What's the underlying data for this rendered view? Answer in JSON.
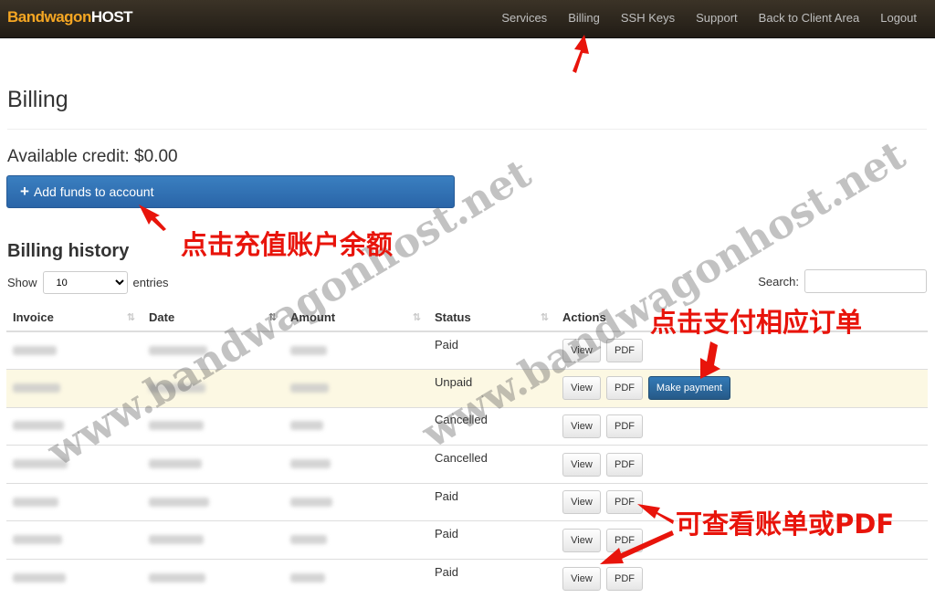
{
  "brand": {
    "part1": "Bandwagon",
    "part2": "HOST"
  },
  "nav": [
    "Services",
    "Billing",
    "SSH Keys",
    "Support",
    "Back to Client Area",
    "Logout"
  ],
  "page_title": "Billing",
  "credit": "Available credit: $0.00",
  "add_funds": {
    "icon": "+",
    "label": "Add funds to account"
  },
  "history_title": "Billing history",
  "show": {
    "prefix": "Show",
    "value": "10",
    "suffix": "entries"
  },
  "search": {
    "label": "Search:",
    "placeholder": ""
  },
  "columns": [
    "Invoice",
    "Date",
    "Amount",
    "Status",
    "Actions"
  ],
  "sort_icon": "⇅",
  "rows": [
    {
      "status": "Paid",
      "view": "View",
      "pdf": "PDF"
    },
    {
      "status": "Unpaid",
      "view": "View",
      "pdf": "PDF",
      "pay": "Make payment"
    },
    {
      "status": "Cancelled",
      "view": "View",
      "pdf": "PDF"
    },
    {
      "status": "Cancelled",
      "view": "View",
      "pdf": "PDF"
    },
    {
      "status": "Paid",
      "view": "View",
      "pdf": "PDF"
    },
    {
      "status": "Paid",
      "view": "View",
      "pdf": "PDF"
    },
    {
      "status": "Paid",
      "view": "View",
      "pdf": "PDF"
    }
  ],
  "annotations": {
    "add_funds": "点击充值账户余额",
    "pay": "点击支付相应订单",
    "pdf": "可查看账单或PDF"
  },
  "watermark": "www.bandwagonhost.net",
  "colors": {
    "annotation": "#e8140b",
    "primary": "#2a6ab0",
    "brand": "#f5a623"
  }
}
